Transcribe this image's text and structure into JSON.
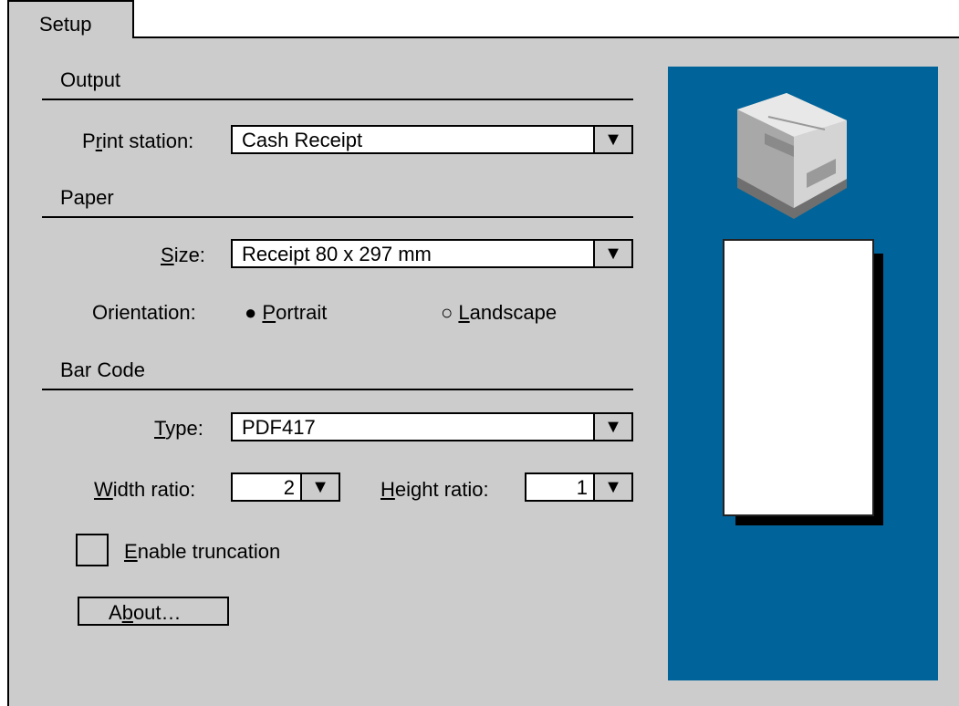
{
  "tab": {
    "label": "Setup"
  },
  "sections": {
    "output": "Output",
    "paper": "Paper",
    "barcode": "Bar Code"
  },
  "output": {
    "print_station_label_pre": "P",
    "print_station_label_ul": "r",
    "print_station_label_post": "int station:",
    "print_station_value": "Cash Receipt"
  },
  "paper": {
    "size_label_ul": "S",
    "size_label_post": "ize:",
    "size_value": "Receipt 80 x 297 mm",
    "orientation_label": "Orientation:",
    "portrait_bullet": "●",
    "portrait_ul": "P",
    "portrait_post": "ortrait",
    "landscape_bullet": "○",
    "landscape_ul": "L",
    "landscape_post": "andscape"
  },
  "barcode": {
    "type_label_ul": "T",
    "type_label_post": "ype:",
    "type_value": "PDF417",
    "width_label_ul": "W",
    "width_label_post": "idth ratio:",
    "width_value": "2",
    "height_label_ul": "H",
    "height_label_post": "eight ratio:",
    "height_value": "1",
    "truncation_ul": "E",
    "truncation_post": "nable truncation",
    "truncation_checked": false
  },
  "about": {
    "pre": "A",
    "ul": "b",
    "post": "out…"
  },
  "dropdown_glyph": "▼",
  "colors": {
    "dialog_bg": "#cccccc",
    "preview_bg": "#00649a"
  },
  "icons": {
    "printer": "receipt-printer-icon"
  }
}
